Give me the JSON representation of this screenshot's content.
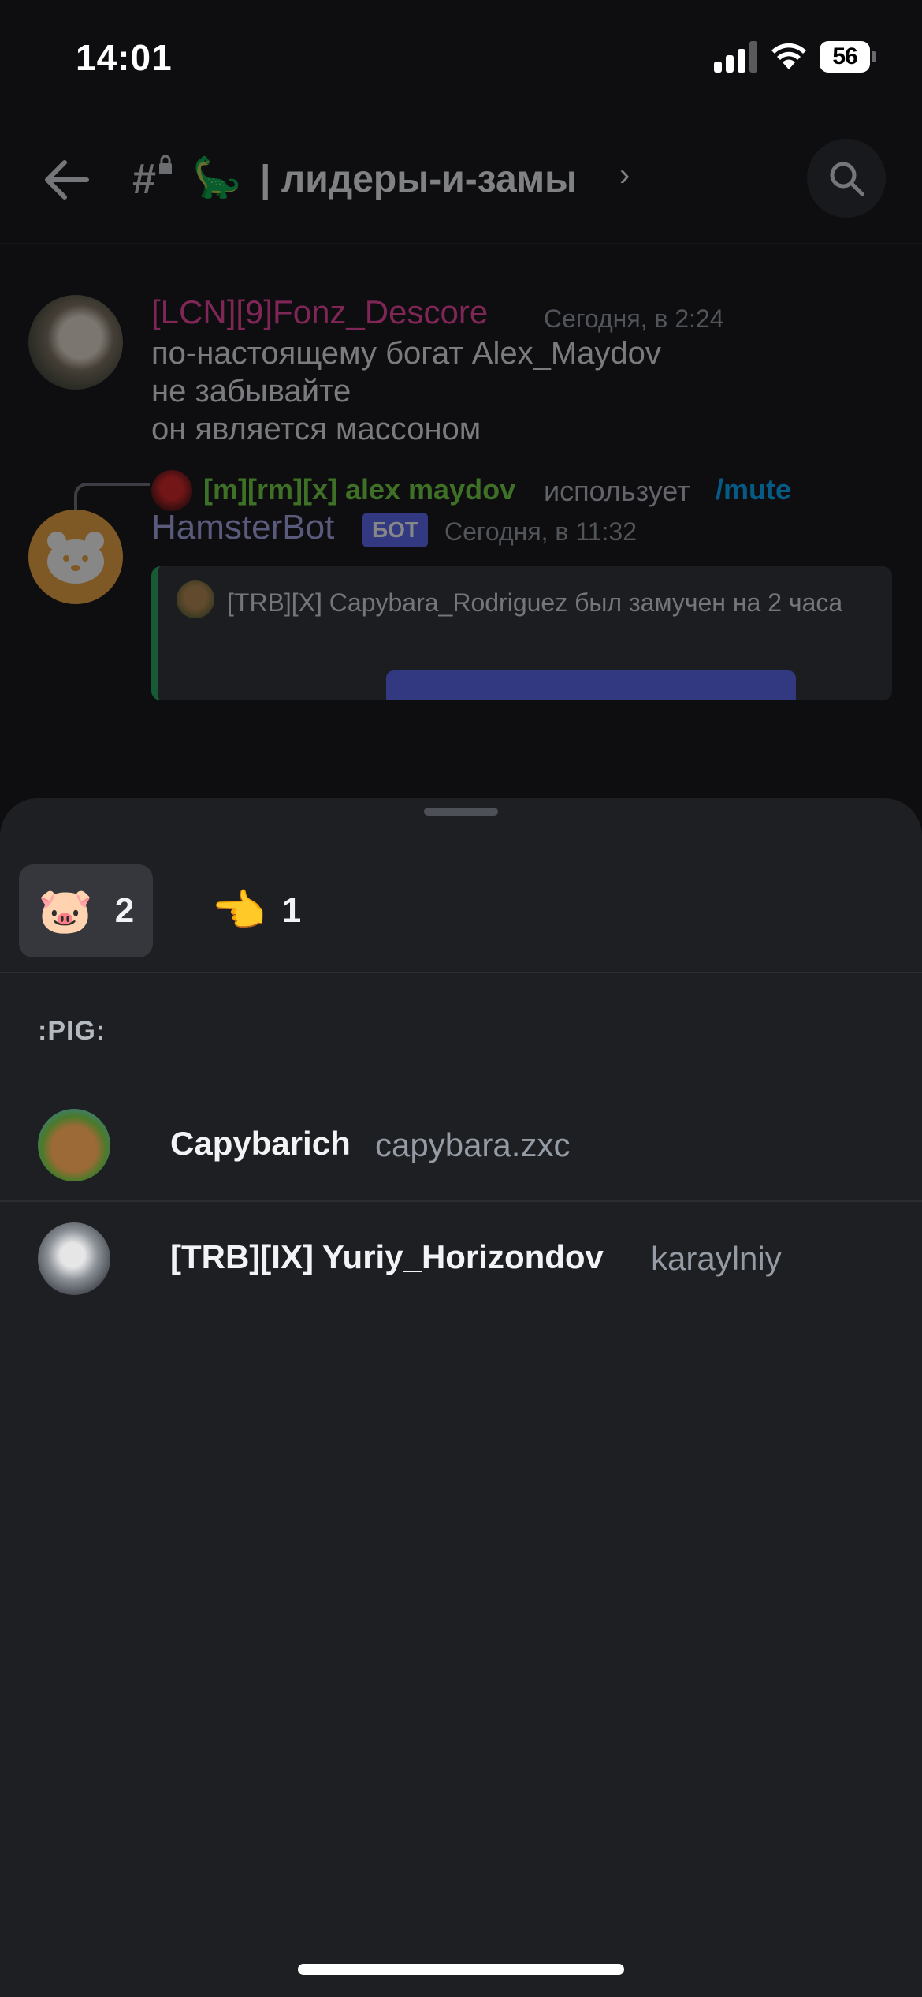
{
  "status_bar": {
    "time": "14:01",
    "battery": "56",
    "icons": [
      "signal-icon",
      "wifi-icon",
      "battery-icon"
    ]
  },
  "channel": {
    "hash_icon": "#",
    "emoji": "🦕",
    "name": "| лидеры-и-замы",
    "chevron": "›",
    "icons": [
      "back-arrow-icon",
      "lock-icon",
      "search-icon"
    ]
  },
  "messages": [
    {
      "author": "[LCN][9]Fonz_Descore",
      "author_color": "#f23f9e",
      "time": "Сегодня, в 2:24",
      "lines": [
        "по-настоящему богат Alex_Maydov",
        "не забывайте",
        "он является массоном"
      ]
    },
    {
      "reply": {
        "user": "[m][rm][x] alex maydov",
        "user_color": "#6fd33c",
        "action": "использует",
        "command": "/mute"
      },
      "author": "HamsterBot",
      "badge": "БОТ",
      "time": "Сегодня, в 11:32",
      "embed_text": "[TRB][X] Capybara_Rodriguez был замучен на 2 часа",
      "embed_accent": "#23a55a"
    }
  ],
  "reactions_sheet": {
    "tabs": [
      {
        "emoji": "🐷",
        "count": "2",
        "active": true
      },
      {
        "emoji": "👈",
        "count": "1",
        "active": false
      }
    ],
    "section_label": ":PIG:",
    "users": [
      {
        "display_name": "Capybarich",
        "username": "capybara.zxc"
      },
      {
        "display_name": "[TRB][IX] Yuriy_Horizondov",
        "username": "karaylniy"
      }
    ]
  }
}
